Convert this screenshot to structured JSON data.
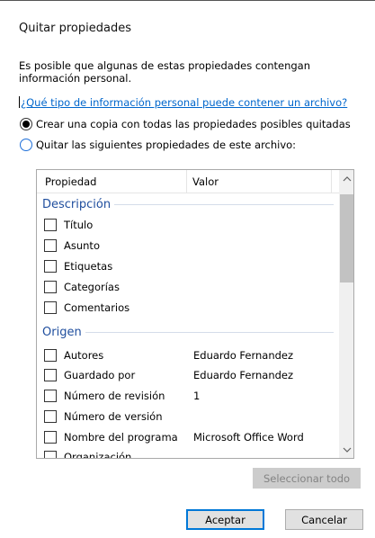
{
  "dialog": {
    "title": "Quitar propiedades",
    "description": "Es posible que algunas de estas propiedades contengan información personal.",
    "help_link": "¿Qué tipo de información personal puede contener un archivo?",
    "options": [
      {
        "label": "Crear una copia con todas las propiedades posibles quitadas",
        "selected": true
      },
      {
        "label": "Quitar las siguientes propiedades de este archivo:",
        "selected": false
      }
    ]
  },
  "property_list": {
    "columns": [
      "Propiedad",
      "Valor"
    ],
    "groups": [
      {
        "label": "Descripción",
        "items": [
          {
            "label": "Título",
            "value": "",
            "checked": false
          },
          {
            "label": "Asunto",
            "value": "",
            "checked": false
          },
          {
            "label": "Etiquetas",
            "value": "",
            "checked": false
          },
          {
            "label": "Categorías",
            "value": "",
            "checked": false
          },
          {
            "label": "Comentarios",
            "value": "",
            "checked": false
          }
        ]
      },
      {
        "label": "Origen",
        "items": [
          {
            "label": "Autores",
            "value": "Eduardo Fernandez",
            "checked": false
          },
          {
            "label": "Guardado por",
            "value": "Eduardo Fernandez",
            "checked": false
          },
          {
            "label": "Número de revisión",
            "value": "1",
            "checked": false
          },
          {
            "label": "Número de versión",
            "value": "",
            "checked": false
          },
          {
            "label": "Nombre del programa",
            "value": "Microsoft Office Word",
            "checked": false
          },
          {
            "label": "Organización",
            "value": "",
            "checked": false
          }
        ]
      }
    ]
  },
  "buttons": {
    "select_all": "Seleccionar todo",
    "accept": "Aceptar",
    "cancel": "Cancelar"
  },
  "icons": {
    "scroll_up": "chevron-up-icon",
    "scroll_down": "chevron-down-icon"
  },
  "colors": {
    "link": "#0066cc",
    "group_label": "#1f4e9e",
    "default_button_border": "#0078d7",
    "disabled_button_bg": "#cccccc"
  }
}
